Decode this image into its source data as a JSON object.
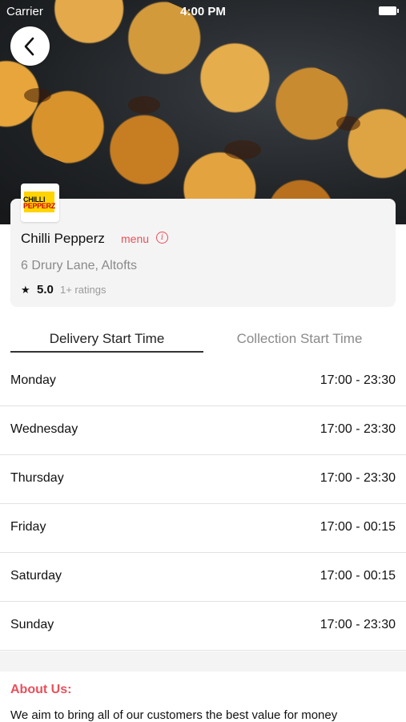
{
  "status_bar": {
    "carrier": "Carrier",
    "time": "4:00 PM"
  },
  "restaurant": {
    "logo_text_top": "CHILLI",
    "logo_text_bottom": "PEPPERZ",
    "name": "Chilli Pepperz",
    "menu_label": "menu",
    "address": "6 Drury Lane, Altofts",
    "rating": "5.0",
    "rating_count": "1+ ratings"
  },
  "tabs": [
    {
      "label": "Delivery Start Time",
      "active": true
    },
    {
      "label": "Collection Start Time",
      "active": false
    }
  ],
  "hours": [
    {
      "day": "Monday",
      "time": "17:00 - 23:30"
    },
    {
      "day": "Wednesday",
      "time": "17:00 - 23:30"
    },
    {
      "day": "Thursday",
      "time": "17:00 - 23:30"
    },
    {
      "day": "Friday",
      "time": "17:00 - 00:15"
    },
    {
      "day": "Saturday",
      "time": "17:00 - 00:15"
    },
    {
      "day": "Sunday",
      "time": "17:00 - 23:30"
    }
  ],
  "about": {
    "title": "About Us:",
    "text": "We aim to bring all of our customers the best value for money"
  },
  "colors": {
    "accent": "#e8505b",
    "text": "#111111",
    "muted": "#8a8a8a"
  },
  "icons": {
    "back": "chevron-left-icon",
    "info": "info-icon",
    "star": "star-icon"
  }
}
